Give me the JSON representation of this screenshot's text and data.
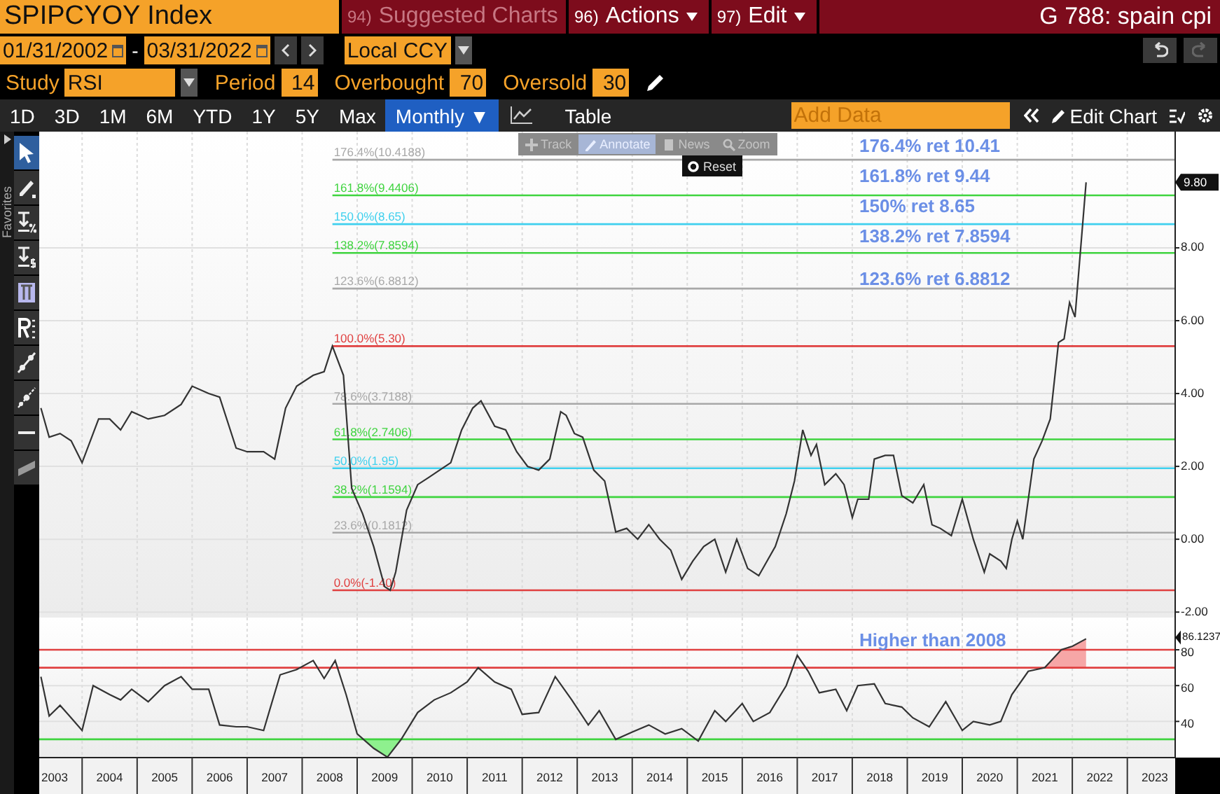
{
  "header": {
    "security": "SPIPCYOY Index",
    "menus": [
      {
        "number": "94)",
        "label": "Suggested Charts",
        "disabled": true,
        "has_menu": false
      },
      {
        "number": "96)",
        "label": "Actions",
        "disabled": false,
        "has_menu": true
      },
      {
        "number": "97)",
        "label": "Edit",
        "disabled": false,
        "has_menu": true
      }
    ],
    "page_title": "G 788: spain cpi"
  },
  "date_range": {
    "start": "01/31/2002",
    "separator": "-",
    "end": "03/31/2022"
  },
  "currency": "Local CCY",
  "study": {
    "label": "Study",
    "value": "RSI",
    "params": [
      {
        "label": "Period",
        "value": "14"
      },
      {
        "label": "Overbought",
        "value": "70"
      },
      {
        "label": "Oversold",
        "value": "30"
      }
    ]
  },
  "periods": [
    {
      "label": "1D",
      "selected": false
    },
    {
      "label": "3D",
      "selected": false
    },
    {
      "label": "1M",
      "selected": false
    },
    {
      "label": "6M",
      "selected": false
    },
    {
      "label": "YTD",
      "selected": false
    },
    {
      "label": "1Y",
      "selected": false
    },
    {
      "label": "5Y",
      "selected": false
    },
    {
      "label": "Max",
      "selected": false
    },
    {
      "label": "Monthly ▼",
      "selected": true
    }
  ],
  "table_label": "Table",
  "add_data": {
    "placeholder": "Add Data"
  },
  "edit_chart": "Edit Chart",
  "favorites_label": "Favorites",
  "tools": [
    {
      "kind": "pointer",
      "selected": true
    },
    {
      "kind": "pencil",
      "selected": false
    },
    {
      "kind": "percent-marker",
      "selected": false
    },
    {
      "kind": "dollar-marker",
      "selected": false
    },
    {
      "kind": "bracket",
      "selected": false
    },
    {
      "kind": "list",
      "selected": false
    },
    {
      "kind": "trend-line",
      "selected": false
    },
    {
      "kind": "dotted-line",
      "selected": false
    },
    {
      "kind": "h-line",
      "selected": false
    },
    {
      "kind": "channel",
      "selected": false
    }
  ],
  "chart_toolbar": [
    {
      "label": "Track",
      "kind": "track",
      "selected": false
    },
    {
      "label": "Annotate",
      "kind": "annotate",
      "selected": true
    },
    {
      "label": "News",
      "kind": "news",
      "selected": false
    },
    {
      "label": "Zoom",
      "kind": "zoom",
      "selected": false
    }
  ],
  "reset_label": "Reset",
  "price_chart": {
    "chart_data": {
      "type": "line",
      "grid": true,
      "xlim": [
        2003.22,
        2023.87
      ],
      "ylim": [
        -2.15,
        11.19
      ],
      "yticks": [
        {
          "value": -2,
          "label": "-2.00"
        },
        {
          "value": 0,
          "label": "0.00"
        },
        {
          "value": 2,
          "label": "2.00"
        },
        {
          "value": 4,
          "label": "4.00"
        },
        {
          "value": 6,
          "label": "6.00"
        },
        {
          "value": 8,
          "label": "8.00"
        }
      ],
      "x": [
        2003.25,
        2003.4,
        2003.6,
        2003.8,
        2004.0,
        2004.3,
        2004.5,
        2004.7,
        2004.9,
        2005.2,
        2005.5,
        2005.8,
        2006.0,
        2006.3,
        2006.5,
        2006.8,
        2007.0,
        2007.3,
        2007.5,
        2007.7,
        2007.9,
        2008.2,
        2008.4,
        2008.55,
        2008.75,
        2008.9,
        2009.1,
        2009.3,
        2009.5,
        2009.6,
        2009.7,
        2009.9,
        2010.1,
        2010.3,
        2010.5,
        2010.7,
        2010.9,
        2011.1,
        2011.25,
        2011.5,
        2011.7,
        2011.9,
        2012.1,
        2012.3,
        2012.5,
        2012.7,
        2012.8,
        2012.95,
        2013.1,
        2013.3,
        2013.5,
        2013.7,
        2013.9,
        2014.1,
        2014.3,
        2014.5,
        2014.7,
        2014.9,
        2015.1,
        2015.3,
        2015.5,
        2015.7,
        2015.9,
        2016.1,
        2016.3,
        2016.6,
        2016.8,
        2016.95,
        2017.1,
        2017.25,
        2017.35,
        2017.5,
        2017.7,
        2017.85,
        2018.0,
        2018.1,
        2018.3,
        2018.4,
        2018.6,
        2018.75,
        2018.9,
        2019.1,
        2019.3,
        2019.45,
        2019.6,
        2019.8,
        2020.0,
        2020.2,
        2020.4,
        2020.5,
        2020.7,
        2020.8,
        2020.9,
        2021.0,
        2021.1,
        2021.3,
        2021.45,
        2021.6,
        2021.75,
        2021.85,
        2021.95,
        2022.05,
        2022.25
      ],
      "series": [
        {
          "color": "#333333",
          "values": [
            3.6,
            2.8,
            2.9,
            2.7,
            2.1,
            3.3,
            3.3,
            3.0,
            3.5,
            3.3,
            3.4,
            3.7,
            4.2,
            4.0,
            3.9,
            2.5,
            2.4,
            2.4,
            2.2,
            3.6,
            4.2,
            4.5,
            4.6,
            5.3,
            4.5,
            1.4,
            0.7,
            -0.2,
            -1.3,
            -1.4,
            -0.9,
            0.8,
            1.5,
            1.7,
            1.9,
            2.1,
            3.0,
            3.6,
            3.8,
            3.1,
            3.0,
            2.4,
            2.0,
            1.9,
            2.2,
            3.5,
            3.4,
            2.9,
            2.8,
            1.9,
            1.6,
            0.2,
            0.3,
            0.0,
            0.4,
            0.0,
            -0.3,
            -1.1,
            -0.6,
            -0.2,
            0.0,
            -0.9,
            0.0,
            -0.8,
            -1.0,
            -0.2,
            0.7,
            1.6,
            3.0,
            2.3,
            2.6,
            1.5,
            1.8,
            1.5,
            0.6,
            1.1,
            1.1,
            2.2,
            2.3,
            2.3,
            1.2,
            1.0,
            1.5,
            0.4,
            0.3,
            0.1,
            1.1,
            0.0,
            -0.9,
            -0.4,
            -0.6,
            -0.8,
            0.0,
            0.5,
            0.0,
            2.2,
            2.7,
            3.3,
            5.4,
            5.5,
            6.5,
            6.1,
            9.8
          ]
        }
      ],
      "ref_lines": [
        {
          "axis": "y",
          "value": 10.4188,
          "label": "176.4%(10.4188)",
          "color": "#a8a8a8"
        },
        {
          "axis": "y",
          "value": 9.4406,
          "label": "161.8%(9.4406)",
          "color": "#3fd43f"
        },
        {
          "axis": "y",
          "value": 8.65,
          "label": "150.0%(8.65)",
          "color": "#3fd0ee"
        },
        {
          "axis": "y",
          "value": 7.8594,
          "label": "138.2%(7.8594)",
          "color": "#3fd43f"
        },
        {
          "axis": "y",
          "value": 6.8812,
          "label": "123.6%(6.8812)",
          "color": "#a8a8a8"
        },
        {
          "axis": "y",
          "value": 5.3,
          "label": "100.0%(5.30)",
          "color": "#e04040"
        },
        {
          "axis": "y",
          "value": 3.7188,
          "label": "78.6%(3.7188)",
          "color": "#a8a8a8"
        },
        {
          "axis": "y",
          "value": 2.7406,
          "label": "61.8%(2.7406)",
          "color": "#3fd43f"
        },
        {
          "axis": "y",
          "value": 1.95,
          "label": "50.0%(1.95)",
          "color": "#3fd0ee"
        },
        {
          "axis": "y",
          "value": 1.1594,
          "label": "38.2%(1.1594)",
          "color": "#3fd43f"
        },
        {
          "axis": "y",
          "value": 0.1812,
          "label": "23.6%(0.1812)",
          "color": "#a8a8a8"
        },
        {
          "axis": "y",
          "value": -1.4,
          "label": "0.0%(-1.40)",
          "color": "#e04040"
        }
      ],
      "annotations": [
        "176.4% ret 10.41",
        "161.8% ret 9.44",
        "150% ret 8.65",
        "138.2% ret 7.8594",
        "123.6% ret 6.8812"
      ],
      "value_labels": [
        "9.80"
      ]
    }
  },
  "rsi_chart": {
    "chart_data": {
      "type": "line",
      "grid": true,
      "xlim": [
        2003.22,
        2023.87
      ],
      "ylim": [
        19.8,
        98
      ],
      "yticks": [
        40,
        60,
        80
      ],
      "xticks": [
        {
          "value": 2003.5,
          "label": "2003"
        },
        {
          "value": 2004.5,
          "label": "2004"
        },
        {
          "value": 2005.5,
          "label": "2005"
        },
        {
          "value": 2006.5,
          "label": "2006"
        },
        {
          "value": 2007.5,
          "label": "2007"
        },
        {
          "value": 2008.5,
          "label": "2008"
        },
        {
          "value": 2009.5,
          "label": "2009"
        },
        {
          "value": 2010.5,
          "label": "2010"
        },
        {
          "value": 2011.5,
          "label": "2011"
        },
        {
          "value": 2012.5,
          "label": "2012"
        },
        {
          "value": 2013.5,
          "label": "2013"
        },
        {
          "value": 2014.5,
          "label": "2014"
        },
        {
          "value": 2015.5,
          "label": "2015"
        },
        {
          "value": 2016.5,
          "label": "2016"
        },
        {
          "value": 2017.5,
          "label": "2017"
        },
        {
          "value": 2018.5,
          "label": "2018"
        },
        {
          "value": 2019.5,
          "label": "2019"
        },
        {
          "value": 2020.5,
          "label": "2020"
        },
        {
          "value": 2021.5,
          "label": "2021"
        },
        {
          "value": 2022.5,
          "label": "2022"
        },
        {
          "value": 2023.5,
          "label": "2023"
        }
      ],
      "x": [
        2003.25,
        2003.4,
        2003.6,
        2003.8,
        2004.0,
        2004.2,
        2004.5,
        2004.7,
        2004.9,
        2005.2,
        2005.5,
        2005.8,
        2006.0,
        2006.3,
        2006.5,
        2006.8,
        2007.0,
        2007.3,
        2007.6,
        2007.9,
        2008.2,
        2008.4,
        2008.6,
        2008.8,
        2009.0,
        2009.3,
        2009.55,
        2009.8,
        2010.1,
        2010.4,
        2010.7,
        2011.0,
        2011.2,
        2011.5,
        2011.8,
        2012.0,
        2012.3,
        2012.6,
        2012.9,
        2013.2,
        2013.4,
        2013.7,
        2014.0,
        2014.3,
        2014.6,
        2014.9,
        2015.2,
        2015.5,
        2015.7,
        2016.0,
        2016.2,
        2016.5,
        2016.8,
        2017.0,
        2017.2,
        2017.4,
        2017.7,
        2017.9,
        2018.1,
        2018.4,
        2018.6,
        2018.9,
        2019.1,
        2019.4,
        2019.7,
        2020.0,
        2020.2,
        2020.5,
        2020.7,
        2020.9,
        2021.2,
        2021.5,
        2021.8,
        2022.0,
        2022.25
      ],
      "series": [
        {
          "color": "#333333",
          "values": [
            65,
            43,
            49,
            42,
            35,
            60,
            55,
            52,
            58,
            51,
            60,
            65,
            58,
            58,
            38,
            37,
            37,
            35,
            66,
            69,
            74,
            64,
            74,
            55,
            33,
            25,
            20,
            30,
            45,
            52,
            56,
            62,
            70,
            62,
            58,
            44,
            45,
            65,
            52,
            38,
            46,
            30,
            34,
            38,
            33,
            36,
            29,
            46,
            40,
            50,
            40,
            45,
            60,
            77,
            68,
            56,
            58,
            46,
            60,
            61,
            50,
            48,
            42,
            37,
            51,
            35,
            40,
            38,
            40,
            55,
            68,
            70,
            80,
            82,
            86.1
          ]
        }
      ],
      "ref_lines": [
        {
          "axis": "y",
          "value": 80,
          "color": "#e04040"
        },
        {
          "axis": "y",
          "value": 70,
          "color": "#e04040"
        },
        {
          "axis": "y",
          "value": 30,
          "color": "#3fd43f"
        }
      ],
      "annotations": [
        "Higher than 2008"
      ],
      "value_labels": [
        "86.1237"
      ]
    }
  }
}
